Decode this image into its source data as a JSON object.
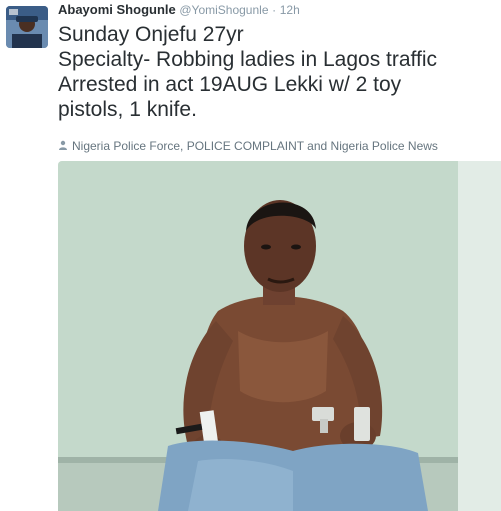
{
  "tweet": {
    "author_name": "Abayomi Shogunle",
    "author_handle": "@YomiShogunle",
    "separator": "·",
    "time": "12h",
    "text_lines": [
      "Sunday Onjefu 27yr",
      "Specialty- Robbing ladies in Lagos traffic",
      "Arrested in act 19AUG Lekki w/ 2 toy",
      "pistols, 1 knife."
    ],
    "tagged_people": "Nigeria Police Force, POLICE COMPLAINT and Nigeria Police News",
    "tag_icon": "person-icon",
    "photo": {
      "description_icon": "photo"
    }
  },
  "colors": {
    "text": "#292f33",
    "secondary": "#8899a6",
    "wall": "#c9ddd0"
  }
}
